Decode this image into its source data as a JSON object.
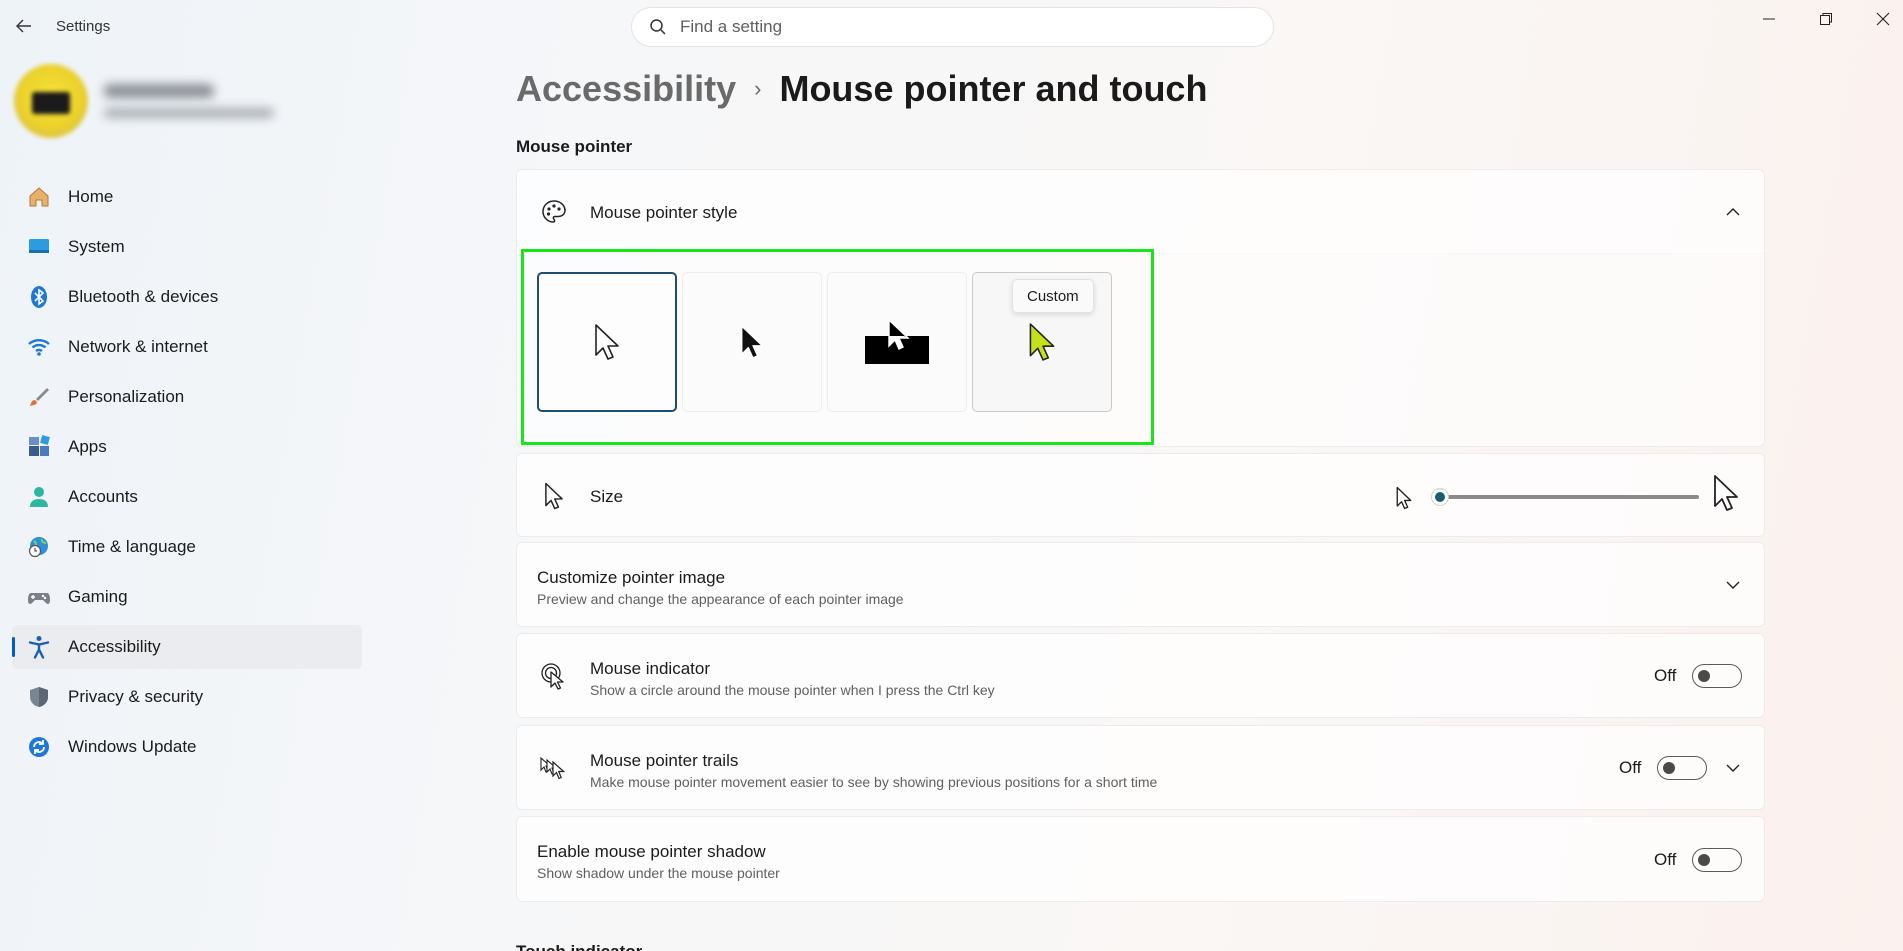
{
  "window": {
    "title": "Settings",
    "search_placeholder": "Find a setting"
  },
  "sidebar": {
    "items": [
      {
        "label": "Home",
        "icon": "home-icon",
        "active": false
      },
      {
        "label": "System",
        "icon": "system-icon",
        "active": false
      },
      {
        "label": "Bluetooth & devices",
        "icon": "bluetooth-icon",
        "active": false
      },
      {
        "label": "Network & internet",
        "icon": "wifi-icon",
        "active": false
      },
      {
        "label": "Personalization",
        "icon": "brush-icon",
        "active": false
      },
      {
        "label": "Apps",
        "icon": "apps-icon",
        "active": false
      },
      {
        "label": "Accounts",
        "icon": "accounts-icon",
        "active": false
      },
      {
        "label": "Time & language",
        "icon": "globe-clock-icon",
        "active": false
      },
      {
        "label": "Gaming",
        "icon": "gamepad-icon",
        "active": false
      },
      {
        "label": "Accessibility",
        "icon": "accessibility-icon",
        "active": true
      },
      {
        "label": "Privacy & security",
        "icon": "shield-icon",
        "active": false
      },
      {
        "label": "Windows Update",
        "icon": "update-icon",
        "active": false
      }
    ]
  },
  "breadcrumb": {
    "parent": "Accessibility",
    "separator": "›",
    "current": "Mouse pointer and touch"
  },
  "section": {
    "mouse_pointer": "Mouse pointer",
    "touch": "Touch indicator"
  },
  "pointer_style": {
    "title": "Mouse pointer style",
    "tooltip": "Custom",
    "selected_index": 0,
    "options": [
      "White",
      "Black",
      "Inverted",
      "Custom"
    ],
    "custom_color": "#c6e01a"
  },
  "size": {
    "title": "Size",
    "value_fraction": 0.0
  },
  "customize": {
    "title": "Customize pointer image",
    "desc": "Preview and change the appearance of each pointer image"
  },
  "indicator": {
    "title": "Mouse indicator",
    "desc": "Show a circle around the mouse pointer when I press the Ctrl key",
    "state": "Off"
  },
  "trails": {
    "title": "Mouse pointer trails",
    "desc": "Make mouse pointer movement easier to see by showing previous positions for a short time",
    "state": "Off"
  },
  "shadow": {
    "title": "Enable mouse pointer shadow",
    "desc": "Show shadow under the mouse pointer",
    "state": "Off"
  },
  "colors": {
    "accent": "#005fb8",
    "highlight": "#19e619"
  }
}
